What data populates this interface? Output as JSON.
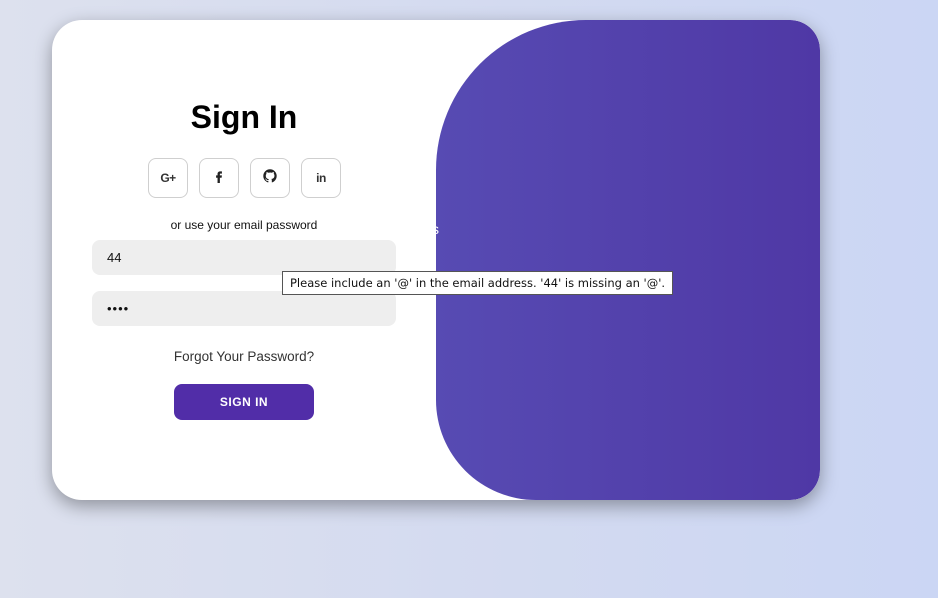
{
  "signin": {
    "title": "Sign In",
    "social": [
      {
        "name": "google",
        "label": "G+"
      },
      {
        "name": "facebook",
        "label": "f"
      },
      {
        "name": "github",
        "label": ""
      },
      {
        "name": "linkedin",
        "label": "in"
      }
    ],
    "hint": "or use your email password",
    "email_value": "44",
    "password_value": "••••",
    "forgot_label": "Forgot Your Password?",
    "submit_label": "SIGN IN"
  },
  "overlay": {
    "partial_text": "s"
  },
  "tooltip": {
    "message": "Please include an '@' in the email address. '44' is missing an '@'."
  },
  "colors": {
    "accent": "#512da8",
    "panel_start": "#574bb3",
    "panel_end": "#4f38a5",
    "input_bg": "#eeeeee"
  }
}
